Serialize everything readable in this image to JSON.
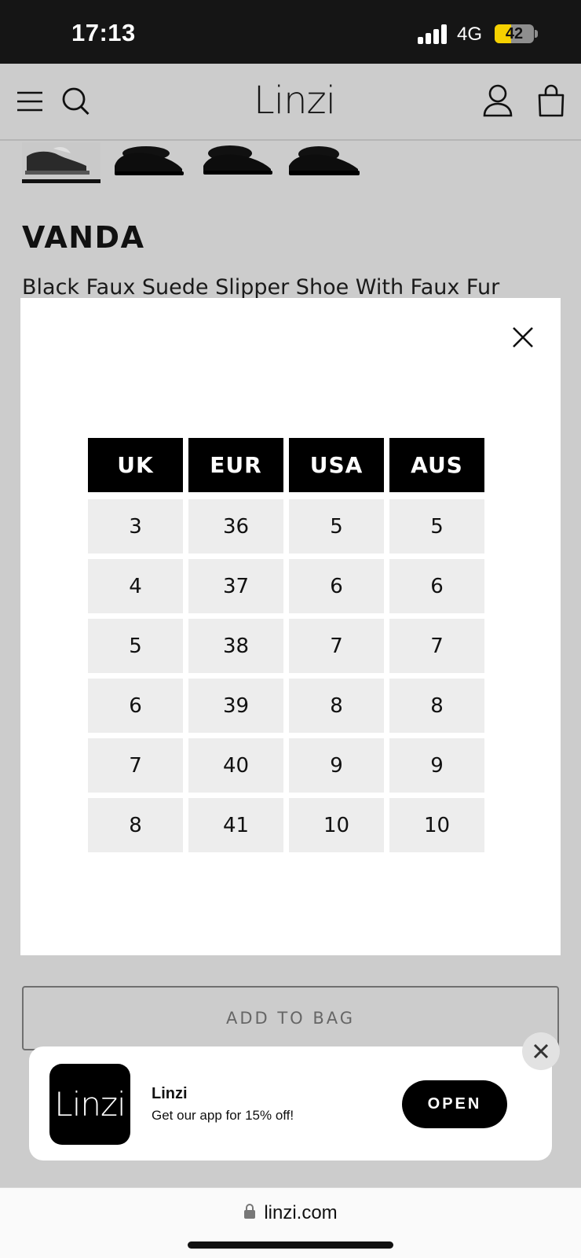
{
  "status_bar": {
    "time": "17:13",
    "network": "4G",
    "battery": "42",
    "battery_level": 0.42
  },
  "header": {
    "logo": "Linzi",
    "menu_icon": "hamburger-menu-icon",
    "search_icon": "search-icon",
    "account_icon": "user-icon",
    "bag_icon": "shopping-bag-icon"
  },
  "product": {
    "name": "VANDA",
    "subtitle": "Black Faux Suede Slipper Shoe With Faux Fur"
  },
  "size_chart": {
    "headers": [
      "UK",
      "EUR",
      "USA",
      "AUS"
    ],
    "rows": [
      [
        "3",
        "36",
        "5",
        "5"
      ],
      [
        "4",
        "37",
        "6",
        "6"
      ],
      [
        "5",
        "38",
        "7",
        "7"
      ],
      [
        "6",
        "39",
        "8",
        "8"
      ],
      [
        "7",
        "40",
        "9",
        "9"
      ],
      [
        "8",
        "41",
        "10",
        "10"
      ]
    ]
  },
  "add_to_bag": "ADD TO BAG",
  "app_banner": {
    "icon_text": "Linzi",
    "name": "Linzi",
    "promo": "Get our app for 15% off!",
    "open": "OPEN"
  },
  "url_bar": {
    "url": "linzi.com"
  },
  "colors": {
    "overlay_bg": "#cccccc",
    "table_header": "#000000",
    "table_cell": "#ededed",
    "battery_fill": "#f5d100"
  }
}
